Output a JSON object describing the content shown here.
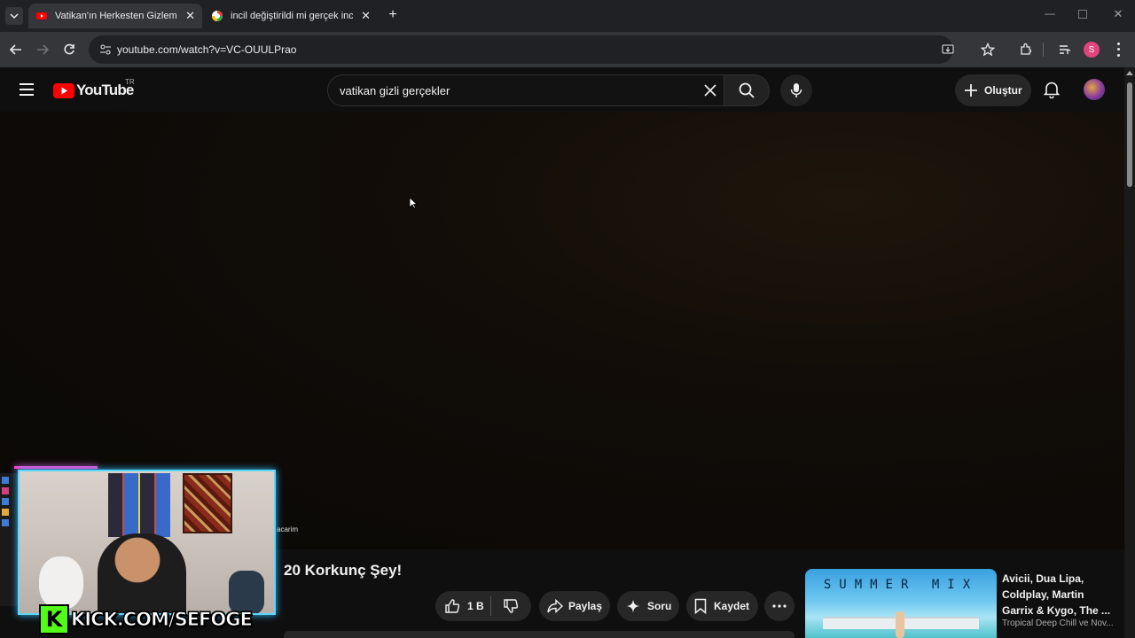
{
  "browser": {
    "tabs": [
      {
        "title": "Vatikan'ın Herkesten Gizlemeye",
        "active": true
      },
      {
        "title": "incil değiştirildi mi gerçek incil",
        "active": false
      }
    ],
    "url": "youtube.com/watch?v=VC-OUULPrao",
    "profile_initial": "S"
  },
  "youtube": {
    "logo_text": "YouTube",
    "region": "TR",
    "search_value": "vatikan gizli gerçekler",
    "create_label": "Oluştur"
  },
  "video": {
    "title_partial": "20 Korkunç Şey!",
    "like_count": "1 B",
    "share_label": "Paylaş",
    "ask_label": "Soru",
    "save_label": "Kaydet"
  },
  "recommendation": {
    "thumb_text": "SUMMER MIX",
    "title": "Avicii, Dua Lipa, Coldplay, Martin Garrix & Kygo, The ...",
    "channel": "Tropical Deep Chill ve Nov..."
  },
  "overlay": {
    "kick_text": "KICK.COM/SEFOGE",
    "chat_fragment": "acarim"
  },
  "colors": {
    "yt_red": "#ff0000",
    "kick_green": "#53fc18",
    "profile_pink": "#e0457b"
  }
}
